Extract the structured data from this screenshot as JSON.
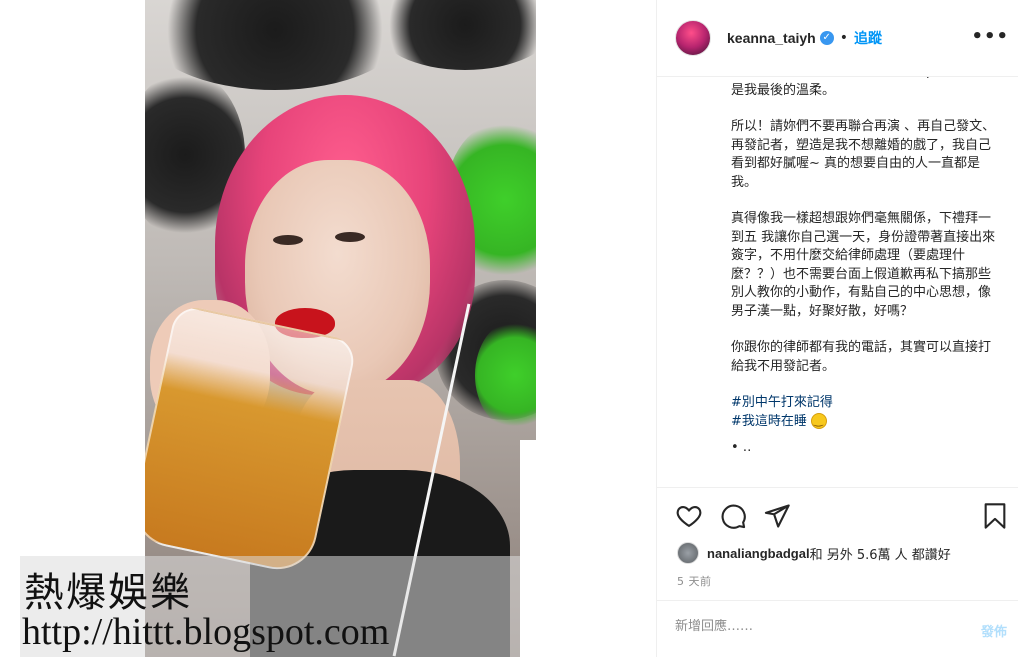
{
  "watermark": {
    "title": "熱爆娛樂",
    "url": "http://hittt.blogspot.com"
  },
  "header": {
    "username": "keanna_taiyh",
    "separator": "•",
    "follow_label": "追蹤",
    "more_icon": "more-horizontal-icon",
    "more_label": "•••"
  },
  "caption": {
    "paragraphs": [
      "我已經對你很好了一沒自你目來別po這篇，這是我最後的溫柔。",
      "所以！請妳們不要再聯合再演 、再自己發文、再發記者，塑造是我不想離婚的戲了，我自己看到都好膩喔~ 真的想要自由的人一直都是我。",
      "真得像我一樣超想跟妳們毫無關係，下禮拜一到五 我讓你自己選一天，身份證帶著直接出來簽字，不用什麼交給律師處理（要處理什麼？？）也不需要台面上假道歉再私下搞那些別人教你的小動作，有點自己的中心思想，像男子漢一點，好聚好散，好嗎？",
      "你跟你的律師都有我的電話，其實可以直接打給我不用發記者。"
    ],
    "hashtags": [
      "#別中午打來記得",
      "#我這時在睡"
    ],
    "more": "• ‥"
  },
  "actions": {
    "like_icon": "heart-icon",
    "comment_icon": "comment-icon",
    "share_icon": "paper-plane-icon",
    "save_icon": "bookmark-icon"
  },
  "likes": {
    "user": "nanaliangbadgal",
    "rest": " 和 另外 5.6萬 人 都讚好"
  },
  "timestamp": "5 天前",
  "comment": {
    "placeholder": "新增回應……",
    "post_label": "發佈"
  },
  "colors": {
    "accent": "#0095f6",
    "verified": "#3897f0",
    "hashtag": "#00376b",
    "muted": "#8e8e8e"
  }
}
